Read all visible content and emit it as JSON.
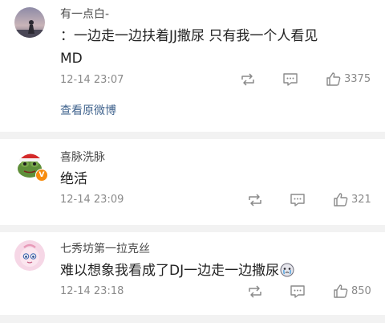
{
  "comments": [
    {
      "username": "有一点白-",
      "content_line1": "：一边走一边扶着JJ撒尿 只有我一个人看见",
      "content_line2": "MD",
      "time": "12-14 23:07",
      "likes": "3375",
      "view_original": "查看原微博",
      "avatar_icon": "silhouette-dusk-avatar"
    },
    {
      "username": "喜脉洗脉",
      "content": "绝活",
      "time": "12-14 23:09",
      "likes": "321",
      "avatar_icon": "frog-christmas-hat-avatar",
      "badge_icon": "verified-v-badge-icon",
      "badge": "V"
    },
    {
      "username": "七秀坊第一拉克丝",
      "content": "难以想象我看成了DJ一边走一边撒尿",
      "time": "12-14 23:18",
      "likes": "850",
      "avatar_icon": "pink-cartoon-avatar",
      "emoji_icon": "crying-face-emoji"
    }
  ],
  "colors": {
    "link": "#41648e",
    "meta": "#8a8a8a",
    "text": "#222222",
    "separator": "#f2f2f2",
    "badge": "#f78c0f"
  }
}
